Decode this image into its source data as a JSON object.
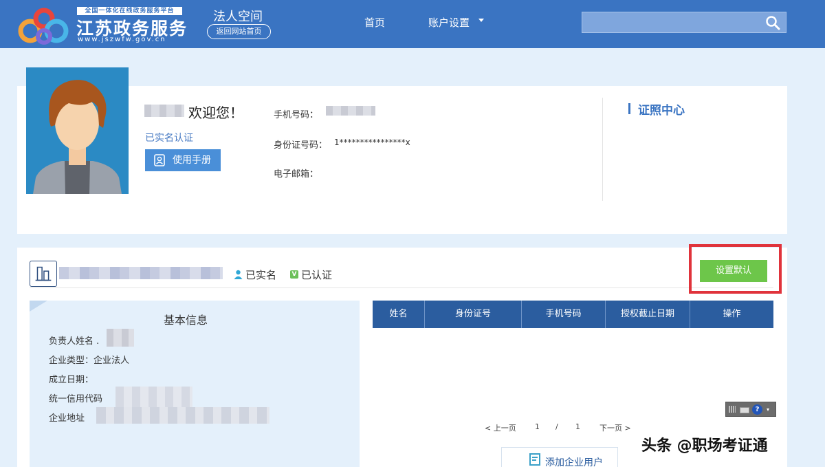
{
  "header": {
    "logo_tagline": "全国一体化在线政务服务平台",
    "logo_title": "江苏政务服务",
    "logo_url": "www.jszwfw.gov.cn",
    "space_title": "法人空间",
    "back_label": "返回网站首页",
    "nav_home": "首页",
    "nav_account": "账户设置",
    "search_value": ""
  },
  "profile": {
    "welcome": "欢迎您！",
    "verified": "已实名认证",
    "manual_label": "使用手册",
    "phone_label": "手机号码：",
    "id_label": "身份证号码：",
    "id_value": "1****************x",
    "email_label": "电子邮箱：",
    "cert_center": "证照中心"
  },
  "company": {
    "realname": "已实名",
    "certified": "已认证",
    "cert_badge": "V",
    "set_default_label": "设置默认",
    "basic_info_title": "基本信息",
    "fields": {
      "manager": "负责人姓名 .",
      "type": "企业类型：企业法人",
      "founded": "成立日期：",
      "credit_code": "统一信用代码",
      "address": "企业地址"
    },
    "table": {
      "headers": [
        "姓名",
        "身份证号",
        "手机号码",
        "授权截止日期",
        "操作"
      ]
    },
    "pager": {
      "prev": "< 上一页",
      "current": "1",
      "sep": "/",
      "total": "1",
      "next": "下一页 >"
    },
    "add_user_label": "添加企业用户"
  },
  "colors": {
    "header_bg": "#3a74c2",
    "accent_green": "#6dc64a",
    "highlight_red": "#e0333b",
    "table_head": "#2b5d9f"
  },
  "watermark": "头条 @职场考证通"
}
